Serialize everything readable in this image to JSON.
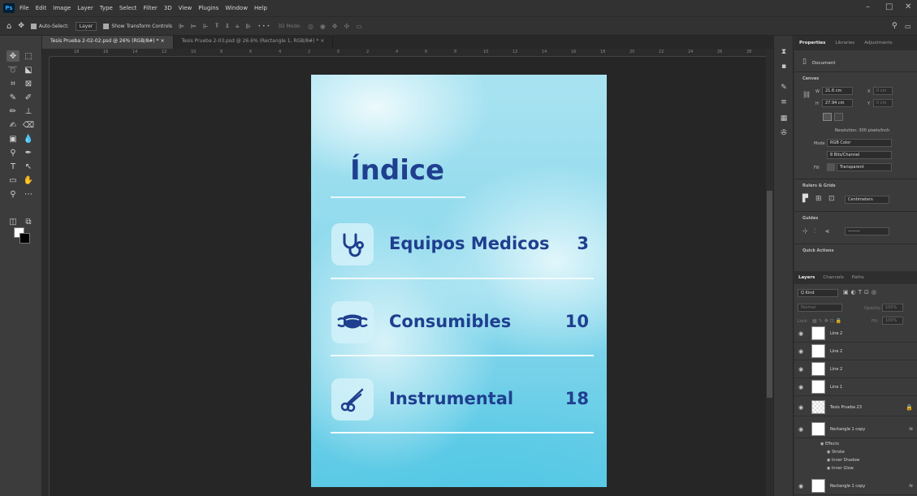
{
  "app": {
    "logo": "Ps"
  },
  "menu": [
    "File",
    "Edit",
    "Image",
    "Layer",
    "Type",
    "Select",
    "Filter",
    "3D",
    "View",
    "Plugins",
    "Window",
    "Help"
  ],
  "window_controls": {
    "minimize": "–",
    "maximize": "□",
    "close": "✕"
  },
  "options_bar": {
    "auto_select_label": "Auto-Select:",
    "auto_select_value": "Layer",
    "transform_label": "Show Transform Controls",
    "more": "•••",
    "mode_3d": "3D Mode:"
  },
  "tabs": [
    {
      "label": "Tesis Prueba 2-02-02.psd @ 26% (RGB/8#) *",
      "close": "×"
    },
    {
      "label": "Tesis Prueba 2-03.psd @ 26.6% (Rectangle 1, RGB/8#) *",
      "close": "×"
    }
  ],
  "ruler_ticks": [
    "18",
    "16",
    "14",
    "12",
    "10",
    "8",
    "6",
    "4",
    "2",
    "0",
    "2",
    "4",
    "6",
    "8",
    "10",
    "12",
    "14",
    "16",
    "18",
    "20",
    "22",
    "24",
    "26",
    "28"
  ],
  "document": {
    "title": "Índice",
    "entries": [
      {
        "label": "Equipos Medicos",
        "page": "3",
        "icon": "stethoscope-icon"
      },
      {
        "label": "Consumibles",
        "page": "10",
        "icon": "face-mask-icon"
      },
      {
        "label": "Instrumental",
        "page": "18",
        "icon": "scissors-icon"
      }
    ],
    "colors": {
      "title": "#1f3f8f",
      "bg_top": "#a9e3f1",
      "bg_bottom": "#5bc9e5"
    }
  },
  "properties": {
    "tabs": [
      "Properties",
      "Libraries",
      "Adjustments"
    ],
    "document_label": "Document",
    "canvas_header": "Canvas",
    "w_label": "W",
    "w_value": "21.6 cm",
    "h_label": "H",
    "h_value": "27.94 cm",
    "x_label": "X",
    "x_value": "0 cm",
    "y_label": "Y",
    "y_value": "0 cm",
    "resolution": "Resolution: 300 pixels/inch",
    "mode_label": "Mode",
    "mode_value": "RGB Color",
    "bits_value": "8 Bits/Channel",
    "fill_label": "Fill",
    "fill_value": "Transparent",
    "rulers_header": "Rulers & Grids",
    "units_value": "Centimeters",
    "guides_header": "Guides",
    "quick_actions_header": "Quick Actions"
  },
  "layers_panel": {
    "tabs": [
      "Layers",
      "Channels",
      "Paths"
    ],
    "kind_label": "Q Kind",
    "blend_mode": "Normal",
    "opacity_label": "Opacity:",
    "opacity_value": "100%",
    "lock_label": "Lock:",
    "fill_label": "Fill:",
    "fill_value": "100%",
    "layers": [
      {
        "name": "Line 2",
        "checker": false
      },
      {
        "name": "Line 2",
        "checker": false
      },
      {
        "name": "Line 2",
        "checker": false
      },
      {
        "name": "Line 1",
        "checker": false
      },
      {
        "name": "Tesis Prueba 23",
        "checker": true
      },
      {
        "name": "Rectangle 1 copy",
        "checker": false
      },
      {
        "name": "Rectangle 1 copy",
        "checker": false
      }
    ],
    "effects_label": "Effects",
    "effects": [
      "Stroke",
      "Inner Shadow",
      "Inner Glow"
    ],
    "fx": "fx"
  }
}
